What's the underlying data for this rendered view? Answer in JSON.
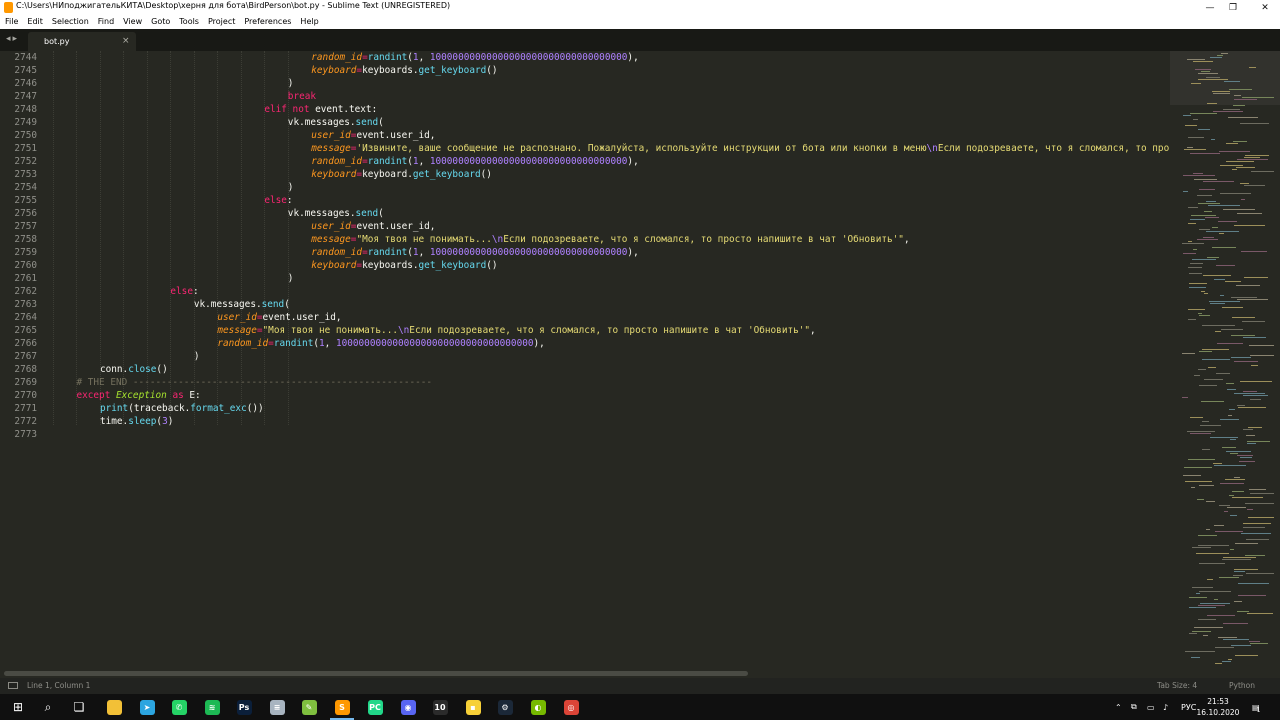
{
  "window": {
    "title": "C:\\Users\\НИподжигательКИТА\\Desktop\\херня для бота\\BirdPerson\\bot.py - Sublime Text (UNREGISTERED)",
    "minimize_glyph": "—",
    "maximize_glyph": "❐",
    "close_glyph": "✕"
  },
  "menu": [
    "File",
    "Edit",
    "Selection",
    "Find",
    "View",
    "Goto",
    "Tools",
    "Project",
    "Preferences",
    "Help"
  ],
  "tabs": {
    "nav_glyph": "◂▸",
    "active": {
      "label": "bot.py",
      "close_glyph": "×"
    }
  },
  "editor": {
    "lines": [
      {
        "n": "2744",
        "indent": 11,
        "t": [
          [
            "pa",
            "random_id"
          ],
          [
            "op",
            "="
          ],
          [
            "fn",
            "randint"
          ],
          [
            "",
            "("
          ],
          [
            "nu",
            "1"
          ],
          [
            "",
            ", "
          ],
          [
            "nu",
            "10000000000000000000000000000000000"
          ],
          [
            "",
            "),"
          ]
        ]
      },
      {
        "n": "2745",
        "indent": 11,
        "t": [
          [
            "pa",
            "keyboard"
          ],
          [
            "op",
            "="
          ],
          [
            "",
            "keyboards."
          ],
          [
            "fn",
            "get_keyboard"
          ],
          [
            "",
            "()"
          ]
        ]
      },
      {
        "n": "2746",
        "indent": 10,
        "t": [
          [
            "",
            ")"
          ]
        ]
      },
      {
        "n": "2747",
        "indent": 10,
        "t": [
          [
            "kw",
            "break"
          ]
        ]
      },
      {
        "n": "2748",
        "indent": 9,
        "t": [
          [
            "kw",
            "elif"
          ],
          [
            "",
            " "
          ],
          [
            "kw",
            "not"
          ],
          [
            "",
            " event.text:"
          ]
        ]
      },
      {
        "n": "2749",
        "indent": 10,
        "t": [
          [
            "",
            "vk.messages."
          ],
          [
            "fn",
            "send"
          ],
          [
            "",
            "("
          ]
        ]
      },
      {
        "n": "2750",
        "indent": 11,
        "t": [
          [
            "pa",
            "user_id"
          ],
          [
            "op",
            "="
          ],
          [
            "",
            "event.user_id,"
          ]
        ]
      },
      {
        "n": "2751",
        "indent": 11,
        "t": [
          [
            "pa",
            "message"
          ],
          [
            "op",
            "="
          ],
          [
            "st",
            "'Извините, ваше сообщение не распознано. Пожалуйста, используйте инструкции от бота или кнопки в меню"
          ],
          [
            "es",
            "\\n"
          ],
          [
            "st",
            "Если подозреваете, что я сломался, то просто напишите в чат 'Обновить''"
          ],
          [
            "",
            ","
          ]
        ]
      },
      {
        "n": "2752",
        "indent": 11,
        "t": [
          [
            "pa",
            "random_id"
          ],
          [
            "op",
            "="
          ],
          [
            "fn",
            "randint"
          ],
          [
            "",
            "("
          ],
          [
            "nu",
            "1"
          ],
          [
            "",
            ", "
          ],
          [
            "nu",
            "10000000000000000000000000000000000"
          ],
          [
            "",
            "),"
          ]
        ]
      },
      {
        "n": "2753",
        "indent": 11,
        "t": [
          [
            "pa",
            "keyboard"
          ],
          [
            "op",
            "="
          ],
          [
            "",
            "keyboard."
          ],
          [
            "fn",
            "get_keyboard"
          ],
          [
            "",
            "()"
          ]
        ]
      },
      {
        "n": "2754",
        "indent": 10,
        "t": [
          [
            "",
            ")"
          ]
        ]
      },
      {
        "n": "2755",
        "indent": 9,
        "t": [
          [
            "kw",
            "else"
          ],
          [
            "",
            ":"
          ]
        ]
      },
      {
        "n": "2756",
        "indent": 10,
        "t": [
          [
            "",
            "vk.messages."
          ],
          [
            "fn",
            "send"
          ],
          [
            "",
            "("
          ]
        ]
      },
      {
        "n": "2757",
        "indent": 11,
        "t": [
          [
            "pa",
            "user_id"
          ],
          [
            "op",
            "="
          ],
          [
            "",
            "event.user_id,"
          ]
        ]
      },
      {
        "n": "2758",
        "indent": 11,
        "t": [
          [
            "pa",
            "message"
          ],
          [
            "op",
            "="
          ],
          [
            "st",
            "\"Моя твоя не понимать..."
          ],
          [
            "es",
            "\\n"
          ],
          [
            "st",
            "Если подозреваете, что я сломался, то просто напишите в чат 'Обновить'\""
          ],
          [
            "",
            ","
          ]
        ]
      },
      {
        "n": "2759",
        "indent": 11,
        "t": [
          [
            "pa",
            "random_id"
          ],
          [
            "op",
            "="
          ],
          [
            "fn",
            "randint"
          ],
          [
            "",
            "("
          ],
          [
            "nu",
            "1"
          ],
          [
            "",
            ", "
          ],
          [
            "nu",
            "10000000000000000000000000000000000"
          ],
          [
            "",
            "),"
          ]
        ]
      },
      {
        "n": "2760",
        "indent": 11,
        "t": [
          [
            "pa",
            "keyboard"
          ],
          [
            "op",
            "="
          ],
          [
            "",
            "keyboards."
          ],
          [
            "fn",
            "get_keyboard"
          ],
          [
            "",
            "()"
          ]
        ]
      },
      {
        "n": "2761",
        "indent": 10,
        "t": [
          [
            "",
            ")"
          ]
        ]
      },
      {
        "n": "2762",
        "indent": 5,
        "t": [
          [
            "kw",
            "else"
          ],
          [
            "",
            ":"
          ]
        ]
      },
      {
        "n": "2763",
        "indent": 6,
        "t": [
          [
            "",
            "vk.messages."
          ],
          [
            "fn",
            "send"
          ],
          [
            "",
            "("
          ]
        ]
      },
      {
        "n": "2764",
        "indent": 7,
        "t": [
          [
            "pa",
            "user_id"
          ],
          [
            "op",
            "="
          ],
          [
            "",
            "event.user_id,"
          ]
        ]
      },
      {
        "n": "2765",
        "indent": 7,
        "t": [
          [
            "pa",
            "message"
          ],
          [
            "op",
            "="
          ],
          [
            "st",
            "\"Моя твоя не понимать..."
          ],
          [
            "es",
            "\\n"
          ],
          [
            "st",
            "Если подозреваете, что я сломался, то просто напишите в чат 'Обновить'\""
          ],
          [
            "",
            ","
          ]
        ]
      },
      {
        "n": "2766",
        "indent": 7,
        "t": [
          [
            "pa",
            "random_id"
          ],
          [
            "op",
            "="
          ],
          [
            "fn",
            "randint"
          ],
          [
            "",
            "("
          ],
          [
            "nu",
            "1"
          ],
          [
            "",
            ", "
          ],
          [
            "nu",
            "10000000000000000000000000000000000"
          ],
          [
            "",
            "),"
          ]
        ]
      },
      {
        "n": "2767",
        "indent": 6,
        "t": [
          [
            "",
            ")"
          ]
        ]
      },
      {
        "n": "2768",
        "indent": 2,
        "t": [
          [
            "",
            "conn."
          ],
          [
            "fn",
            "close"
          ],
          [
            "",
            "()"
          ]
        ]
      },
      {
        "n": "2769",
        "indent": 1,
        "t": [
          [
            "cm",
            "# THE END -----------------------------------------------------"
          ]
        ]
      },
      {
        "n": "2770",
        "indent": 1,
        "t": [
          [
            "kw",
            "except"
          ],
          [
            "",
            " "
          ],
          [
            "cl",
            "Exception"
          ],
          [
            "",
            " "
          ],
          [
            "kw",
            "as"
          ],
          [
            "",
            " E:"
          ]
        ]
      },
      {
        "n": "2771",
        "indent": 2,
        "t": [
          [
            "fn",
            "print"
          ],
          [
            "",
            "(traceback."
          ],
          [
            "fn",
            "format_exc"
          ],
          [
            "",
            "())"
          ]
        ]
      },
      {
        "n": "2772",
        "indent": 2,
        "t": [
          [
            "",
            "time."
          ],
          [
            "fn",
            "sleep"
          ],
          [
            "",
            "("
          ],
          [
            "nu",
            "3"
          ],
          [
            "",
            ")"
          ]
        ]
      },
      {
        "n": "2773",
        "indent": 0,
        "t": []
      }
    ]
  },
  "statusbar": {
    "position": "Line 1, Column 1",
    "tab_size": "Tab Size: 4",
    "syntax": "Python"
  },
  "taskbar": {
    "apps": [
      {
        "name": "start-button",
        "glyph": "⊞",
        "color": "#101010"
      },
      {
        "name": "search-icon",
        "glyph": "⌕",
        "color": "#101010"
      },
      {
        "name": "task-view-icon",
        "glyph": "❏",
        "color": "#101010"
      },
      {
        "name": "file-explorer-icon",
        "glyph": "",
        "color": "#f2c037"
      },
      {
        "name": "telegram-icon",
        "glyph": "➤",
        "color": "#2ca5e0"
      },
      {
        "name": "whatsapp-icon",
        "glyph": "✆",
        "color": "#25d366"
      },
      {
        "name": "spotify-icon",
        "glyph": "≋",
        "color": "#1db954"
      },
      {
        "name": "photoshop-icon",
        "glyph": "Ps",
        "color": "#0b1f3a"
      },
      {
        "name": "notepad-icon",
        "glyph": "≡",
        "color": "#a8b4c0"
      },
      {
        "name": "notepad-plus-icon",
        "glyph": "✎",
        "color": "#7fbf3f"
      },
      {
        "name": "sublime-text-icon",
        "glyph": "S",
        "color": "#ff9800"
      },
      {
        "name": "pycharm-icon",
        "glyph": "PC",
        "color": "#21d789"
      },
      {
        "name": "discord-icon",
        "glyph": "◉",
        "color": "#5865f2"
      },
      {
        "name": "app-10-icon",
        "glyph": "10",
        "color": "#2b2b2b"
      },
      {
        "name": "sticky-notes-icon",
        "glyph": "▪",
        "color": "#f7d038"
      },
      {
        "name": "steam-icon",
        "glyph": "⚙",
        "color": "#1b2838"
      },
      {
        "name": "nvidia-icon",
        "glyph": "◐",
        "color": "#76b900"
      },
      {
        "name": "chrome-icon",
        "glyph": "◎",
        "color": "#db4437"
      }
    ],
    "tray": {
      "chevron": "⌃",
      "icons": [
        "⧉",
        "▭",
        "♪"
      ],
      "language": "РУС",
      "time": "21:53",
      "date": "16.10.2020",
      "notification_glyph": "▤",
      "notification_count": "1"
    }
  }
}
